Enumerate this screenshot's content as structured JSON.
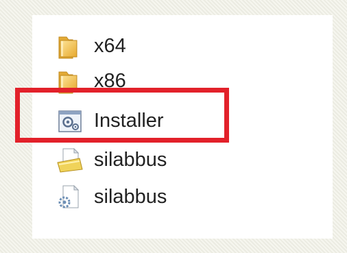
{
  "explorer": {
    "items": [
      {
        "label": "x64",
        "icon": "folder-icon"
      },
      {
        "label": "x86",
        "icon": "folder-icon"
      },
      {
        "label": "Installer",
        "icon": "installer-icon"
      },
      {
        "label": "silabbus",
        "icon": "setup-info-icon"
      },
      {
        "label": "silabbus",
        "icon": "system-file-icon"
      }
    ]
  },
  "colors": {
    "highlight": "#e2212a",
    "folder": "#f1c24e",
    "background": "#f1f1e7",
    "panel": "#ffffff"
  }
}
